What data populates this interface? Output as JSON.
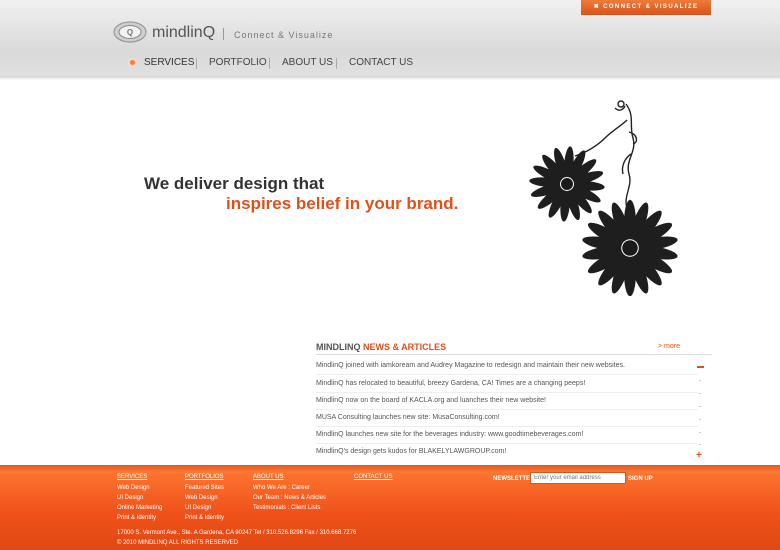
{
  "colors": {
    "accent": "#e2501a",
    "footer": "#f0531a",
    "text": "#444444"
  },
  "top_badge": {
    "label": "CONNECT & VISUALIZE",
    "icon": "arrow-icon"
  },
  "header": {
    "brand": "mindlinQ",
    "tagline": "Connect & Visualize",
    "logo": "mindlinq-logo"
  },
  "nav": {
    "items": [
      {
        "label": "SERVICES",
        "active": true
      },
      {
        "label": "PORTFOLIO",
        "active": false
      },
      {
        "label": "ABOUT US",
        "active": false
      },
      {
        "label": "CONTACT US",
        "active": false
      }
    ]
  },
  "hero": {
    "line1": "We deliver design that",
    "line2": "inspires belief in your brand.",
    "art": "daisy-flowers-illustration"
  },
  "news": {
    "title_prefix": "MINDLINQ",
    "title_accent": "NEWS & ARTICLES",
    "more": "> more",
    "items": [
      "MindlinQ joined with iamkoream and Audrey Magazine to redesign and maintain their new websites.",
      "MindlinQ has relocated to beautiful, breezy Gardena, CA! Times are a changing peeps!",
      "MindlinQ now on the board of KACLA.org and luanches their new website!",
      "MUSA Consulting launches new site: MusaConsulting.com!",
      "MindlinQ launches new site for the beverages industry: www.goodtimebeverages.com!",
      "MindlinQ's design gets kudos for BLAKELYLAWGROUP.com!"
    ]
  },
  "footer": {
    "columns": [
      {
        "head": "SERVICES",
        "links": [
          "Web Design",
          "UI Design",
          "Online Marketing",
          "Print & Identity"
        ]
      },
      {
        "head": "PORTFOLIOS",
        "links": [
          "Featured Sites",
          "Web Design",
          "UI Design",
          "Print & Identity"
        ]
      },
      {
        "head": "ABOUT US",
        "links": [
          "Who We Are : Career",
          "Our Team : News & Articles",
          "Testimonials : Client Lists"
        ]
      },
      {
        "head": "CONTACT US",
        "links": []
      }
    ],
    "newsletter": {
      "label": "NEWSLETTER",
      "placeholder": "Enter your email address",
      "button": "SIGN UP"
    },
    "address": "17000 S. Vermont Ave., Ste. A Gardena, CA 90247 Tel / 310.526.8296 Fax / 310.668.7276",
    "copyright": "© 2010 MINDLINQ ALL RIGHTS RESERVED"
  }
}
